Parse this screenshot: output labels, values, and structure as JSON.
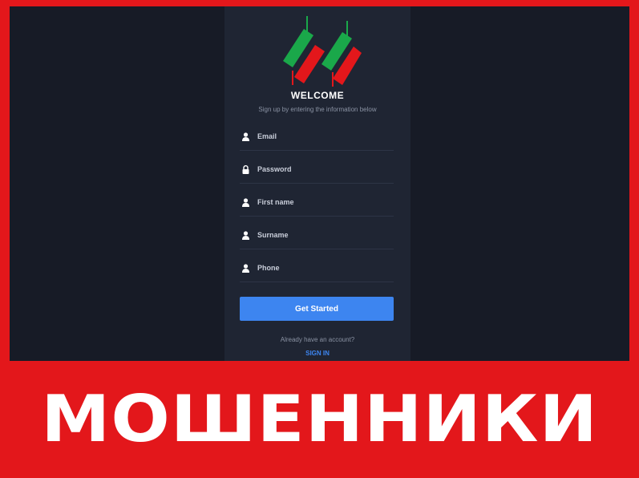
{
  "signup": {
    "title": "WELCOME",
    "subtitle": "Sign up by entering the information below",
    "fields": [
      {
        "placeholder": "Email",
        "icon": "user-icon"
      },
      {
        "placeholder": "Password",
        "icon": "lock-icon"
      },
      {
        "placeholder": "First name",
        "icon": "user-icon"
      },
      {
        "placeholder": "Surname",
        "icon": "user-icon"
      },
      {
        "placeholder": "Phone",
        "icon": "user-icon"
      }
    ],
    "submit_label": "Get Started",
    "already_text": "Already have an account?",
    "signin_label": "SIGN IN"
  },
  "banner": {
    "text": "МОШЕННИКИ"
  },
  "colors": {
    "frame_red": "#e3171b",
    "background": "#171b26",
    "panel": "#1f2533",
    "accent_blue": "#3d85f0",
    "logo_green": "#1aa84a",
    "logo_red": "#e3171b"
  }
}
